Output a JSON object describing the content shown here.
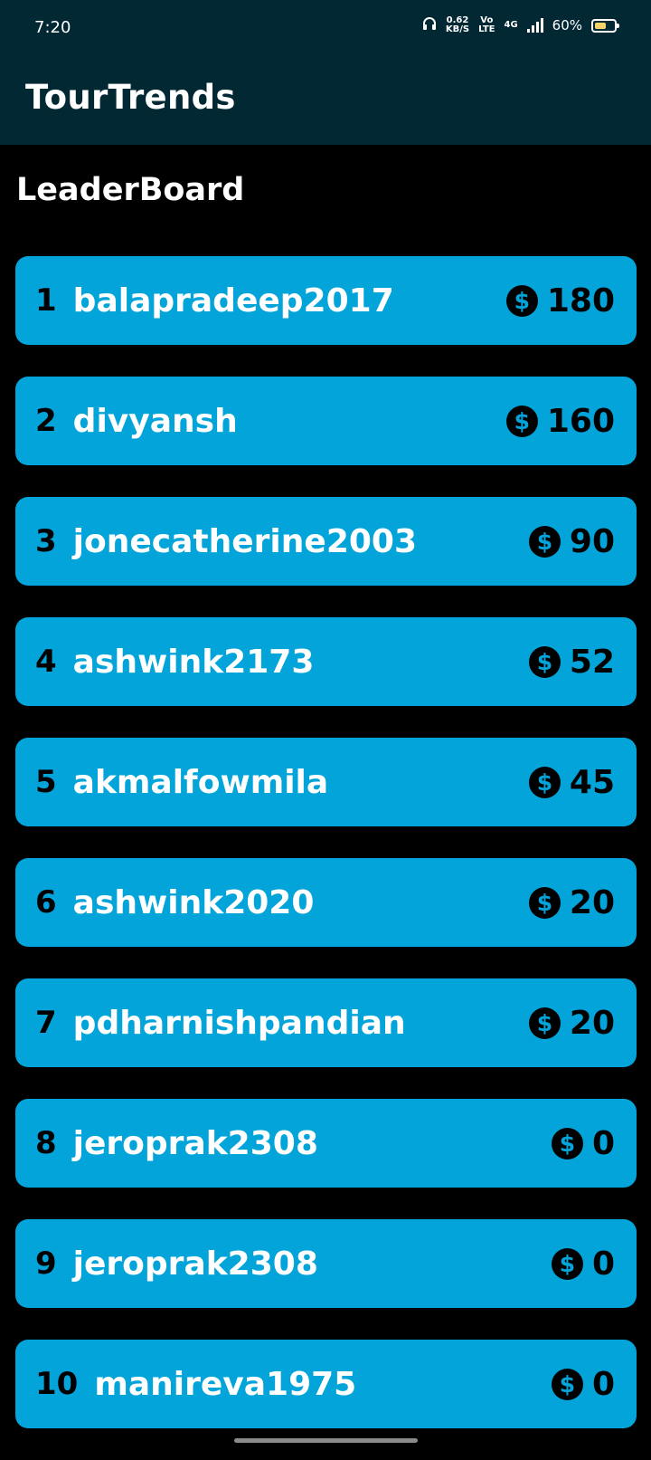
{
  "status_bar": {
    "time": "7:20",
    "speed_value": "0.62",
    "speed_unit": "KB/S",
    "volte_top": "Vo",
    "volte_bottom": "LTE",
    "network": "4G",
    "battery": "60%",
    "battery_level": 0.6,
    "battery_color": "#f6d36b"
  },
  "app": {
    "title": "TourTrends"
  },
  "leaderboard": {
    "title": "LeaderBoard",
    "accent_color": "#02a4d9",
    "entries": [
      {
        "rank": "1",
        "username": "balapradeep2017",
        "points": "180"
      },
      {
        "rank": "2",
        "username": "divyansh",
        "points": "160"
      },
      {
        "rank": "3",
        "username": "jonecatherine2003",
        "points": "90"
      },
      {
        "rank": "4",
        "username": "ashwink2173",
        "points": "52"
      },
      {
        "rank": "5",
        "username": "akmalfowmila",
        "points": "45"
      },
      {
        "rank": "6",
        "username": "ashwink2020",
        "points": "20"
      },
      {
        "rank": "7",
        "username": "pdharnishpandian",
        "points": "20"
      },
      {
        "rank": "8",
        "username": "jeroprak2308",
        "points": "0"
      },
      {
        "rank": "9",
        "username": "jeroprak2308",
        "points": "0"
      },
      {
        "rank": "10",
        "username": "manireva1975",
        "points": "0"
      }
    ]
  },
  "icons": {
    "coin": "dollar-coin-icon"
  }
}
